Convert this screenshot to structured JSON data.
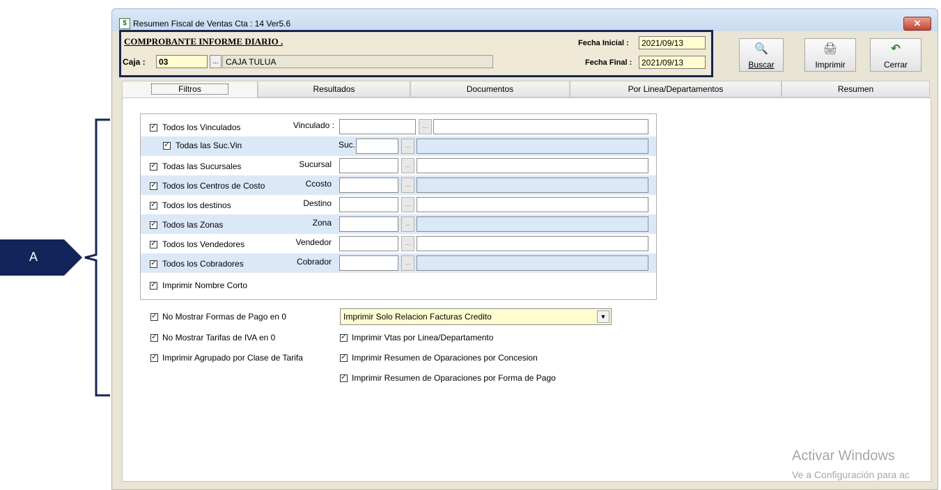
{
  "annotation": {
    "label": "A",
    "color": "#12245a"
  },
  "window": {
    "title": "Resumen Fiscal de Ventas Cta : 14  Ver5.6",
    "close_glyph": "✕"
  },
  "header": {
    "title": "COMPROBANTE  INFORME DIARIO .",
    "caja_label": "Caja :",
    "caja_code": "03",
    "caja_dots": "...",
    "caja_name": "CAJA TULUA",
    "fecha_inicial_label": "Fecha Inicial :",
    "fecha_inicial": "2021/09/13",
    "fecha_final_label": "Fecha Final :",
    "fecha_final": "2021/09/13"
  },
  "toolbar": {
    "buscar": "Buscar",
    "imprimir": "Imprimir",
    "cerrar": "Cerrar"
  },
  "tabs": [
    "Filtros",
    "Resultados",
    "Documentos",
    "Por Linea/Departamentos",
    "Resumen"
  ],
  "filters": [
    {
      "check": "Todos los Vinculados",
      "label": "Vinculado :"
    },
    {
      "check": "Todas las Suc.Vin",
      "label": "Suc."
    },
    {
      "check": "Todas las Sucursales",
      "label": "Sucursal"
    },
    {
      "check": "Todos los Centros de Costo",
      "label": "Ccosto"
    },
    {
      "check": "Todos los destinos",
      "label": "Destino"
    },
    {
      "check": "Todos las Zonas",
      "label": "Zona"
    },
    {
      "check": "Todos los Vendedores",
      "label": "Vendedor"
    },
    {
      "check": "Todos los Cobradores",
      "label": "Cobrador"
    },
    {
      "check": "Imprimir Nombre Corto"
    }
  ],
  "options": {
    "no_formas_pago": "No Mostrar  Formas de Pago en 0",
    "no_tarifas_iva": "No Mostrar Tarifas de IVA  en  0",
    "agrupado_clase": "Imprimir Agrupado por  Clase de Tarifa",
    "dropdown_value": "Imprimir Solo Relacion Facturas Credito",
    "vtas_linea": "Imprimir Vtas por Linea/Departamento",
    "resumen_concesion": "Imprimir Resumen de Oparaciones por Concesion",
    "resumen_forma_pago": "Imprimir Resumen de Oparaciones por Forma de Pago"
  },
  "watermark": {
    "line1": "Activar Windows",
    "line2": "Ve a Configuración para ac"
  }
}
